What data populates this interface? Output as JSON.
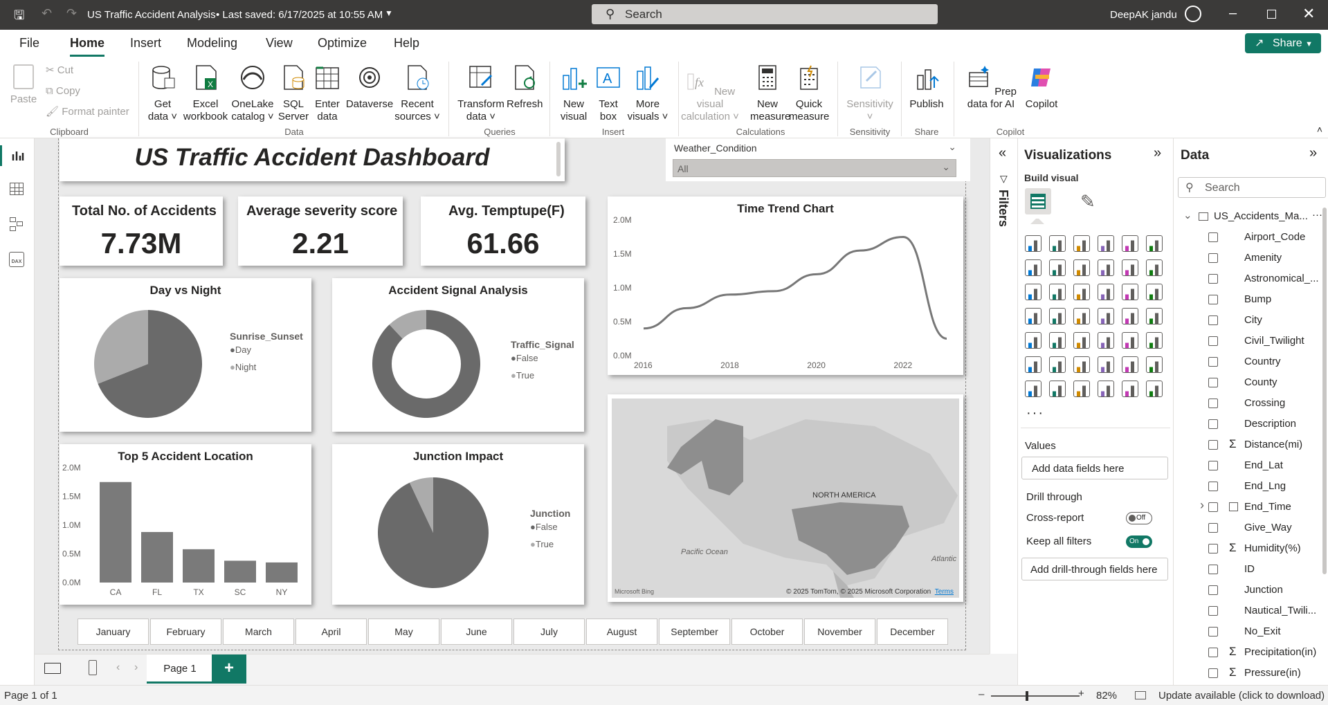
{
  "titlebar": {
    "doc_title": "US Traffic Accident Analysis",
    "saved": "• Last saved: 6/17/2025 at 10:55 AM",
    "search_placeholder": "Search",
    "user": "DeepAK jandu"
  },
  "menu": [
    "File",
    "Home",
    "Insert",
    "Modeling",
    "View",
    "Optimize",
    "Help"
  ],
  "share_label": "Share",
  "ribbon": {
    "paste": "Paste",
    "cut": "Cut",
    "copy": "Copy",
    "format_painter": "Format painter",
    "get_data": "Get data",
    "excel": "Excel workbook",
    "onelake": "OneLake catalog",
    "sql": "SQL Server",
    "enter_data": "Enter data",
    "dataverse": "Dataverse",
    "recent_sources": "Recent sources",
    "transform": "Transform data",
    "refresh": "Refresh",
    "new_visual": "New visual",
    "text_box": "Text box",
    "more_visuals": "More visuals",
    "new_visual_calc": "New visual calculation",
    "new_measure": "New measure",
    "quick_measure": "Quick measure",
    "sensitivity": "Sensitivity",
    "publish": "Publish",
    "prep_ai": "Prep data for AI",
    "copilot": "Copilot",
    "groups": {
      "clipboard": "Clipboard",
      "data": "Data",
      "queries": "Queries",
      "insert": "Insert",
      "calculations": "Calculations",
      "sensitivity": "Sensitivity",
      "share": "Share",
      "copilot": "Copilot"
    }
  },
  "dashboard": {
    "title": "US Traffic Accident Dashboard",
    "slicer_label": "Weather_Condition",
    "slicer_value": "All",
    "kpis": [
      {
        "label": "Total No. of Accidents",
        "value": "7.73M"
      },
      {
        "label": "Average severity score",
        "value": "2.21"
      },
      {
        "label": "Avg. Temptupe(F)",
        "value": "61.66"
      }
    ],
    "day_night": {
      "title": "Day vs Night",
      "legend_title": "Sunrise_Sunset",
      "items": [
        "Day",
        "Night"
      ]
    },
    "signal": {
      "title": "Accident Signal Analysis",
      "legend_title": "Traffic_Signal",
      "items": [
        "False",
        "True"
      ]
    },
    "junction": {
      "title": "Junction Impact",
      "legend_title": "Junction",
      "items": [
        "False",
        "True"
      ]
    },
    "trend": {
      "title": "Time Trend Chart"
    },
    "top5": {
      "title": "Top 5 Accident Location"
    },
    "map": {
      "label_na": "NORTH AMERICA",
      "label_pacific": "Pacific Ocean",
      "label_atlantic": "Atlantic",
      "copyright": "© 2025 TomTom, © 2025 Microsoft Corporation",
      "terms": "Terms",
      "bing": "Microsoft Bing"
    },
    "months": [
      "January",
      "February",
      "March",
      "April",
      "May",
      "June",
      "July",
      "August",
      "September",
      "October",
      "November",
      "December"
    ]
  },
  "chart_data": [
    {
      "type": "pie",
      "title": "Day vs Night",
      "legend_title": "Sunrise_Sunset",
      "categories": [
        "Day",
        "Night"
      ],
      "values": [
        69,
        31
      ]
    },
    {
      "type": "pie",
      "title": "Accident Signal Analysis",
      "legend_title": "Traffic_Signal",
      "categories": [
        "False",
        "True"
      ],
      "values": [
        88,
        12
      ],
      "donut": true
    },
    {
      "type": "pie",
      "title": "Junction Impact",
      "legend_title": "Junction",
      "categories": [
        "False",
        "True"
      ],
      "values": [
        93,
        7
      ]
    },
    {
      "type": "line",
      "title": "Time Trend Chart",
      "x": [
        2016,
        2017,
        2018,
        2019,
        2020,
        2021,
        2022,
        2023
      ],
      "values": [
        0.4,
        0.7,
        0.9,
        0.95,
        1.2,
        1.55,
        1.75,
        0.25
      ],
      "yticks": [
        "0.0M",
        "0.5M",
        "1.0M",
        "1.5M",
        "2.0M"
      ],
      "xticks": [
        "2016",
        "2018",
        "2020",
        "2022"
      ],
      "ylim": [
        0,
        2
      ]
    },
    {
      "type": "bar",
      "title": "Top 5 Accident Location",
      "categories": [
        "CA",
        "FL",
        "TX",
        "SC",
        "NY"
      ],
      "values": [
        1.75,
        0.88,
        0.58,
        0.38,
        0.35
      ],
      "yticks": [
        "0.0M",
        "0.5M",
        "1.0M",
        "1.5M",
        "2.0M"
      ],
      "ylim": [
        0,
        2
      ]
    }
  ],
  "visualizations": {
    "title": "Visualizations",
    "build": "Build visual",
    "values_label": "Values",
    "values_placeholder": "Add data fields here",
    "drill_through": "Drill through",
    "cross_report": "Cross-report",
    "cross_state": "Off",
    "keep_filters": "Keep all filters",
    "keep_state": "On",
    "drill_placeholder": "Add drill-through fields here"
  },
  "filters_label": "Filters",
  "data_panel": {
    "title": "Data",
    "search_placeholder": "Search",
    "table": "US_Accidents_Ma...",
    "fields": [
      {
        "name": "Airport_Code",
        "sigma": false
      },
      {
        "name": "Amenity",
        "sigma": false
      },
      {
        "name": "Astronomical_...",
        "sigma": false
      },
      {
        "name": "Bump",
        "sigma": false
      },
      {
        "name": "City",
        "sigma": false
      },
      {
        "name": "Civil_Twilight",
        "sigma": false
      },
      {
        "name": "Country",
        "sigma": false
      },
      {
        "name": "County",
        "sigma": false
      },
      {
        "name": "Crossing",
        "sigma": false
      },
      {
        "name": "Description",
        "sigma": false
      },
      {
        "name": "Distance(mi)",
        "sigma": true
      },
      {
        "name": "End_Lat",
        "sigma": false
      },
      {
        "name": "End_Lng",
        "sigma": false
      },
      {
        "name": "End_Time",
        "sigma": false
      },
      {
        "name": "Give_Way",
        "sigma": false
      },
      {
        "name": "Humidity(%)",
        "sigma": true
      },
      {
        "name": "ID",
        "sigma": false
      },
      {
        "name": "Junction",
        "sigma": false
      },
      {
        "name": "Nautical_Twili...",
        "sigma": false
      },
      {
        "name": "No_Exit",
        "sigma": false
      },
      {
        "name": "Precipitation(in)",
        "sigma": true
      },
      {
        "name": "Pressure(in)",
        "sigma": true
      }
    ]
  },
  "tabs": {
    "page": "Page 1",
    "add": "+"
  },
  "status": {
    "page": "Page 1 of 1",
    "zoom": "82%",
    "update": "Update available (click to download)"
  }
}
